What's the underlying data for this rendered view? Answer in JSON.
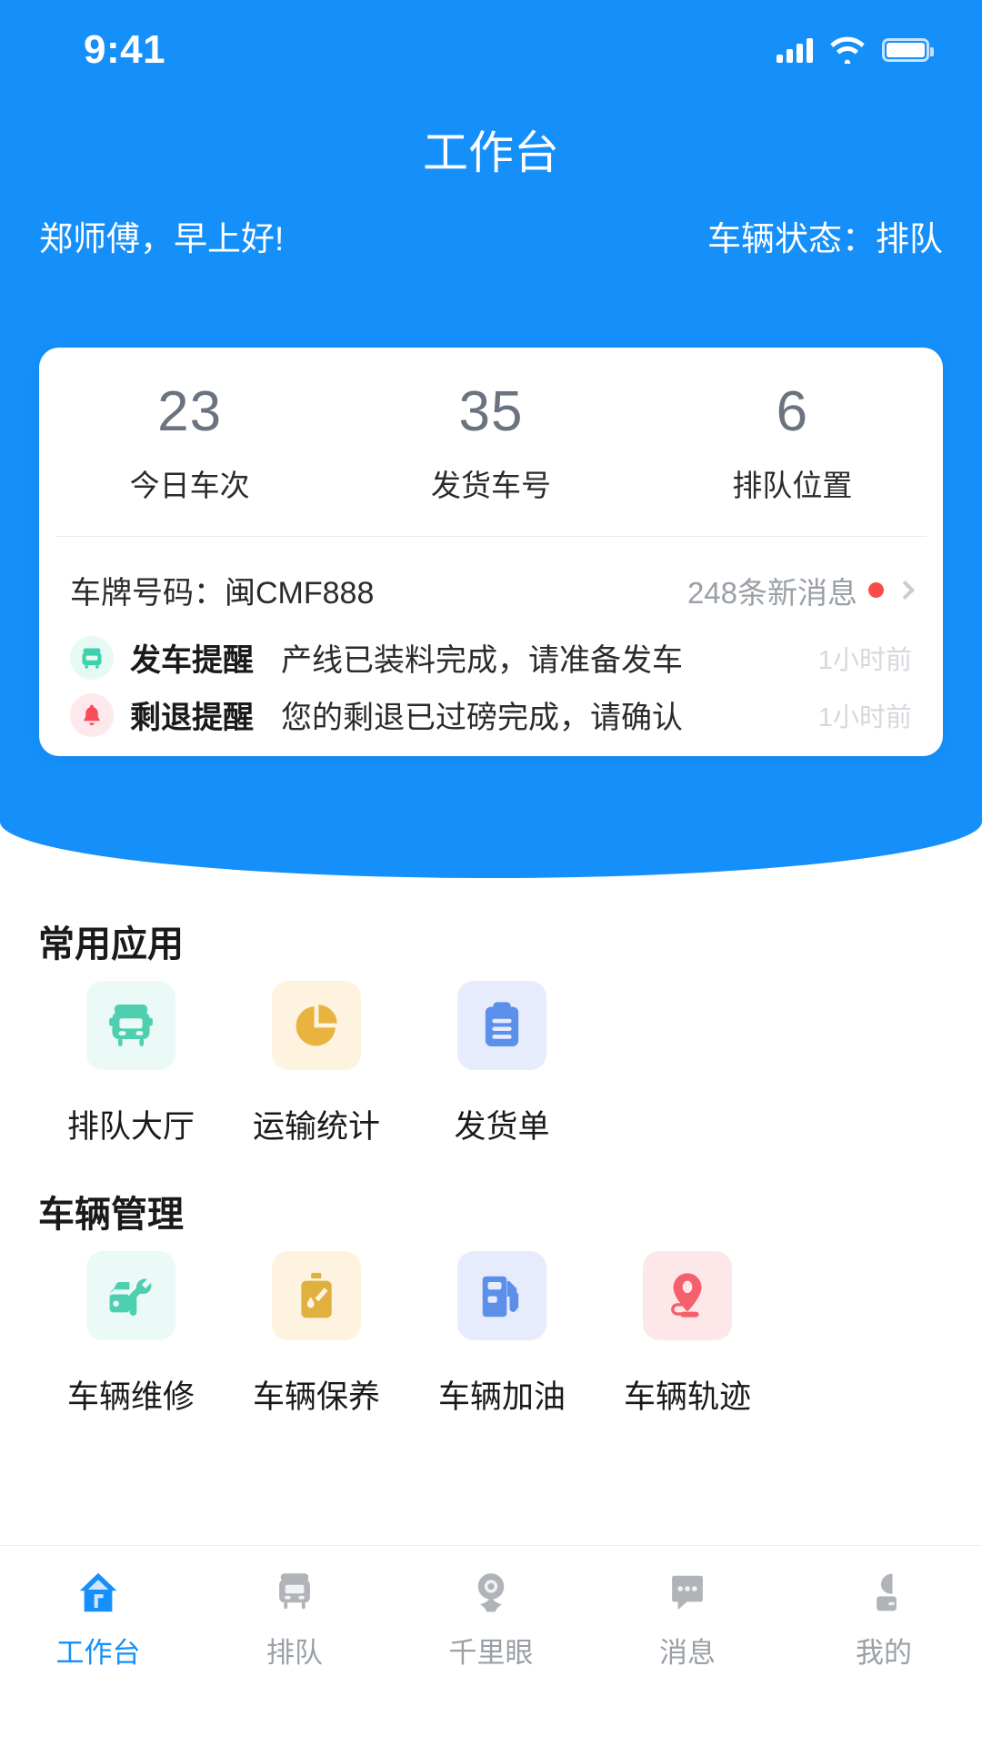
{
  "status_bar": {
    "time": "9:41",
    "signal_icon": "signal-bars-icon",
    "wifi_icon": "wifi-icon",
    "battery_icon": "battery-icon"
  },
  "header": {
    "title": "工作台",
    "greeting": "郑师傅，早上好!",
    "vehicle_status": "车辆状态：排队",
    "background_color": "#1590FA"
  },
  "info_card": {
    "stats": [
      {
        "value": "23",
        "label": "今日车次"
      },
      {
        "value": "35",
        "label": "发货车号"
      },
      {
        "value": "6",
        "label": "排队位置"
      }
    ],
    "plate_label": "车牌号码：闽CMF888",
    "message_count": "248条新消息",
    "message_dot_color": "#FA4B4B",
    "notifications": [
      {
        "icon": "bus-icon",
        "icon_color": "#3FD0AE",
        "icon_bg": "#E6FAF4",
        "title": "发车提醒",
        "body": "产线已装料完成，请准备发车",
        "time": "1小时前"
      },
      {
        "icon": "bell-icon",
        "icon_color": "#FA4B5B",
        "icon_bg": "#FDE9EC",
        "title": "剩退提醒",
        "body": "您的剩退已过磅完成，请确认",
        "time": "1小时前"
      }
    ]
  },
  "sections": [
    {
      "title": "常用应用",
      "items": [
        {
          "label": "排队大厅",
          "icon": "bus-front-icon",
          "icon_color": "#4ECFB0",
          "tile_bg": "#EBFAF6"
        },
        {
          "label": "运输统计",
          "icon": "pie-chart-icon",
          "icon_color": "#E8B33F",
          "tile_bg": "#FDF3DF"
        },
        {
          "label": "发货单",
          "icon": "clipboard-icon",
          "icon_color": "#5C8FEA",
          "tile_bg": "#E6ECFC"
        }
      ]
    },
    {
      "title": "车辆管理",
      "items": [
        {
          "label": "车辆维修",
          "icon": "car-wrench-icon",
          "icon_color": "#4ECFB0",
          "tile_bg": "#EBFAF6"
        },
        {
          "label": "车辆保养",
          "icon": "oil-can-icon",
          "icon_color": "#E0B13E",
          "tile_bg": "#FDF3DF"
        },
        {
          "label": "车辆加油",
          "icon": "fuel-pump-icon",
          "icon_color": "#5C8FEA",
          "tile_bg": "#E6ECFC"
        },
        {
          "label": "车辆轨迹",
          "icon": "location-pin-icon",
          "icon_color": "#F4606C",
          "tile_bg": "#FDE7E9"
        }
      ]
    }
  ],
  "tab_bar": {
    "active_color": "#1590FA",
    "inactive_color": "#9AA0A6",
    "items": [
      {
        "label": "工作台",
        "icon": "home-icon",
        "active": true
      },
      {
        "label": "排队",
        "icon": "bus-icon",
        "active": false
      },
      {
        "label": "千里眼",
        "icon": "camera-eye-icon",
        "active": false
      },
      {
        "label": "消息",
        "icon": "chat-bubble-icon",
        "active": false
      },
      {
        "label": "我的",
        "icon": "person-icon",
        "active": false
      }
    ]
  }
}
